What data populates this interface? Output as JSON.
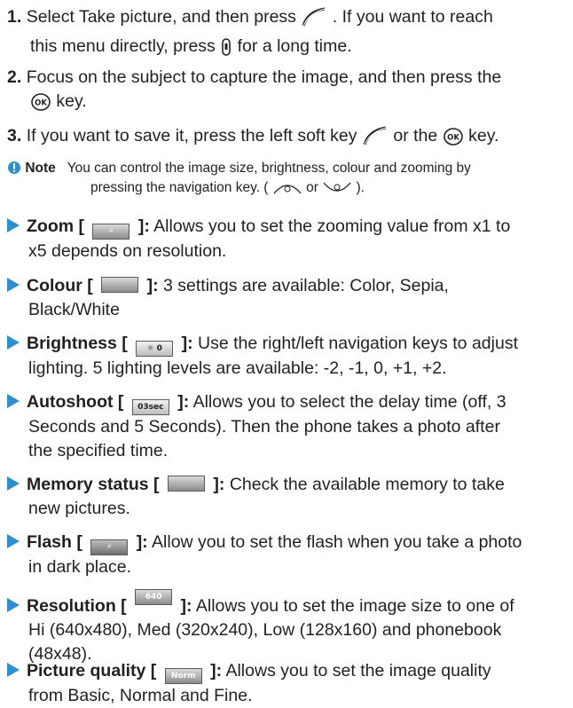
{
  "steps": [
    {
      "num": "1.",
      "line1a": "Select Take picture, and then press",
      "line1b": ". If you want to reach",
      "line2a": "this menu directly, press",
      "line2b": "for a long time."
    },
    {
      "num": "2.",
      "line1": "Focus on the subject to capture the image, and then press the",
      "line2b": "key."
    },
    {
      "num": "3.",
      "line1a": "If you want to save it, press the left soft key",
      "line1b": "or the",
      "line1c": "key."
    }
  ],
  "note": {
    "label": "Note",
    "line1": "You can control the image size, brightness, colour and zooming by",
    "line2a": "pressing the navigation key. (",
    "line2b": "or",
    "line2c": ")."
  },
  "options": [
    {
      "title": "Zoom [",
      "close": "]:",
      "text1": "Allows you to set the zooming value from x1 to",
      "text2": "x5 depends on resolution."
    },
    {
      "title": "Colour [",
      "close": "]:",
      "text1": "3 settings are available: Color, Sepia,",
      "text2": "Black/White"
    },
    {
      "title": "Brightness [",
      "close": "]:",
      "text1": "Use the right/left navigation keys to adjust",
      "text2": "lighting. 5 lighting levels are available: -2, -1, 0, +1, +2."
    },
    {
      "title": "Autoshoot [",
      "close": "]:",
      "text1": "Allows you to select the delay time (off, 3",
      "text2": "Seconds and 5 Seconds). Then the phone takes a photo after",
      "text3": "the specified time."
    },
    {
      "title": "Memory status [",
      "close": "]:",
      "text1": "Check the available memory to take",
      "text2": "new pictures."
    },
    {
      "title": "Flash [",
      "close": "]:",
      "text1": "Allow you to set the flash when you take a photo",
      "text2": "in dark place."
    },
    {
      "title": "Resolution [",
      "close": "]:",
      "text1": "Allows you to set the image size to one of",
      "text2": "Hi (640x480), Med (320x240), Low (128x160) and phonebook",
      "text3": "(48x48)."
    },
    {
      "title": "Picture quality [",
      "close": "]:",
      "text1": "Allows you to set the image quality",
      "text2": "from Basic, Normal and Fine."
    }
  ],
  "icon_labels": {
    "autoshoot": "03sec",
    "brightness": "0",
    "resolution": "640 480",
    "quality": "Norm"
  },
  "colors": {
    "text": "#231f20",
    "accent": "#2b8fd0"
  }
}
